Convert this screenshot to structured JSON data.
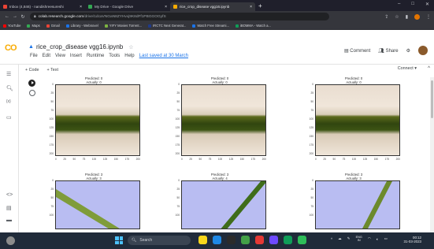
{
  "browser": {
    "tabs": [
      {
        "label": "Inbox (4,846) - nandishreesureshi",
        "color": "#ea4335",
        "active": false
      },
      {
        "label": "My Drive - Google Drive",
        "color": "#34a853",
        "active": false
      },
      {
        "label": "rice_crop_disease vgg16.ipynb",
        "color": "#f9ab00",
        "active": true
      }
    ],
    "new_tab": "+",
    "window_controls": [
      "–",
      "□",
      "✕"
    ],
    "url_host": "colab.research.google.com",
    "url_path": "/drive/1dcaVNGaN8ZYHvxj9K8dFf1PBGGOGyfS",
    "bookmarks": [
      {
        "label": "YouTube",
        "color": "#ff0000"
      },
      {
        "label": "Maps",
        "color": "#34a853"
      },
      {
        "label": "Gmail",
        "color": "#ea4335"
      },
      {
        "label": "Library - Webnovel",
        "color": "#1a73e8"
      },
      {
        "label": "YIFY Movies Torrent...",
        "color": "#7cb342"
      },
      {
        "label": "IRCTC Next Generat...",
        "color": "#1e3a8a"
      },
      {
        "label": "Watch Free Streami...",
        "color": "#1a73e8"
      },
      {
        "label": "iBOMMA - Watch a...",
        "color": "#0f9d58"
      }
    ]
  },
  "colab": {
    "logo": "CO",
    "title": "rice_crop_disease vgg16.ipynb",
    "menu": [
      "File",
      "Edit",
      "View",
      "Insert",
      "Runtime",
      "Tools",
      "Help"
    ],
    "last_saved": "Last saved at 30 March",
    "header_right": {
      "comment": "Comment",
      "share": "Share"
    },
    "toolbar": {
      "code": "+ Code",
      "text": "+ Text",
      "connect": "Connect"
    }
  },
  "plots": [
    {
      "predicted": "Predicted: 0",
      "actually": "Actually: 0",
      "kind": "leaf-top"
    },
    {
      "predicted": "Predicted: 0",
      "actually": "Actually: 0",
      "kind": "leaf-top"
    },
    {
      "predicted": "Predicted: 0",
      "actually": "Actually: 0",
      "kind": "leaf-top"
    },
    {
      "predicted": "Predicted: 3",
      "actually": "Actually: 3",
      "kind": "leaf-bot"
    },
    {
      "predicted": "Predicted: 3",
      "actually": "Actually: 4",
      "kind": "leaf-bot"
    },
    {
      "predicted": "Predicted: 3",
      "actually": "Actually: 3",
      "kind": "leaf-bot"
    }
  ],
  "axis": {
    "y_ticks": [
      "0",
      "25",
      "50",
      "75",
      "100",
      "125",
      "150",
      "175",
      "200"
    ],
    "x_ticks": [
      "0",
      "25",
      "50",
      "75",
      "100",
      "125",
      "150",
      "175",
      "200"
    ],
    "y_ticks_bottom": [
      "0",
      "25",
      "50",
      "75",
      "100"
    ]
  },
  "taskbar": {
    "search": "Search",
    "lang_top": "ENG",
    "lang_bottom": "IN",
    "time": "00:12",
    "date": "31-03-2023",
    "app_colors": [
      "#f9d71c",
      "#1e88e5",
      "#2b2b2b",
      "#43a047",
      "#e53935",
      "#6d4aff",
      "#0f9d58",
      "#2ebd59"
    ]
  }
}
